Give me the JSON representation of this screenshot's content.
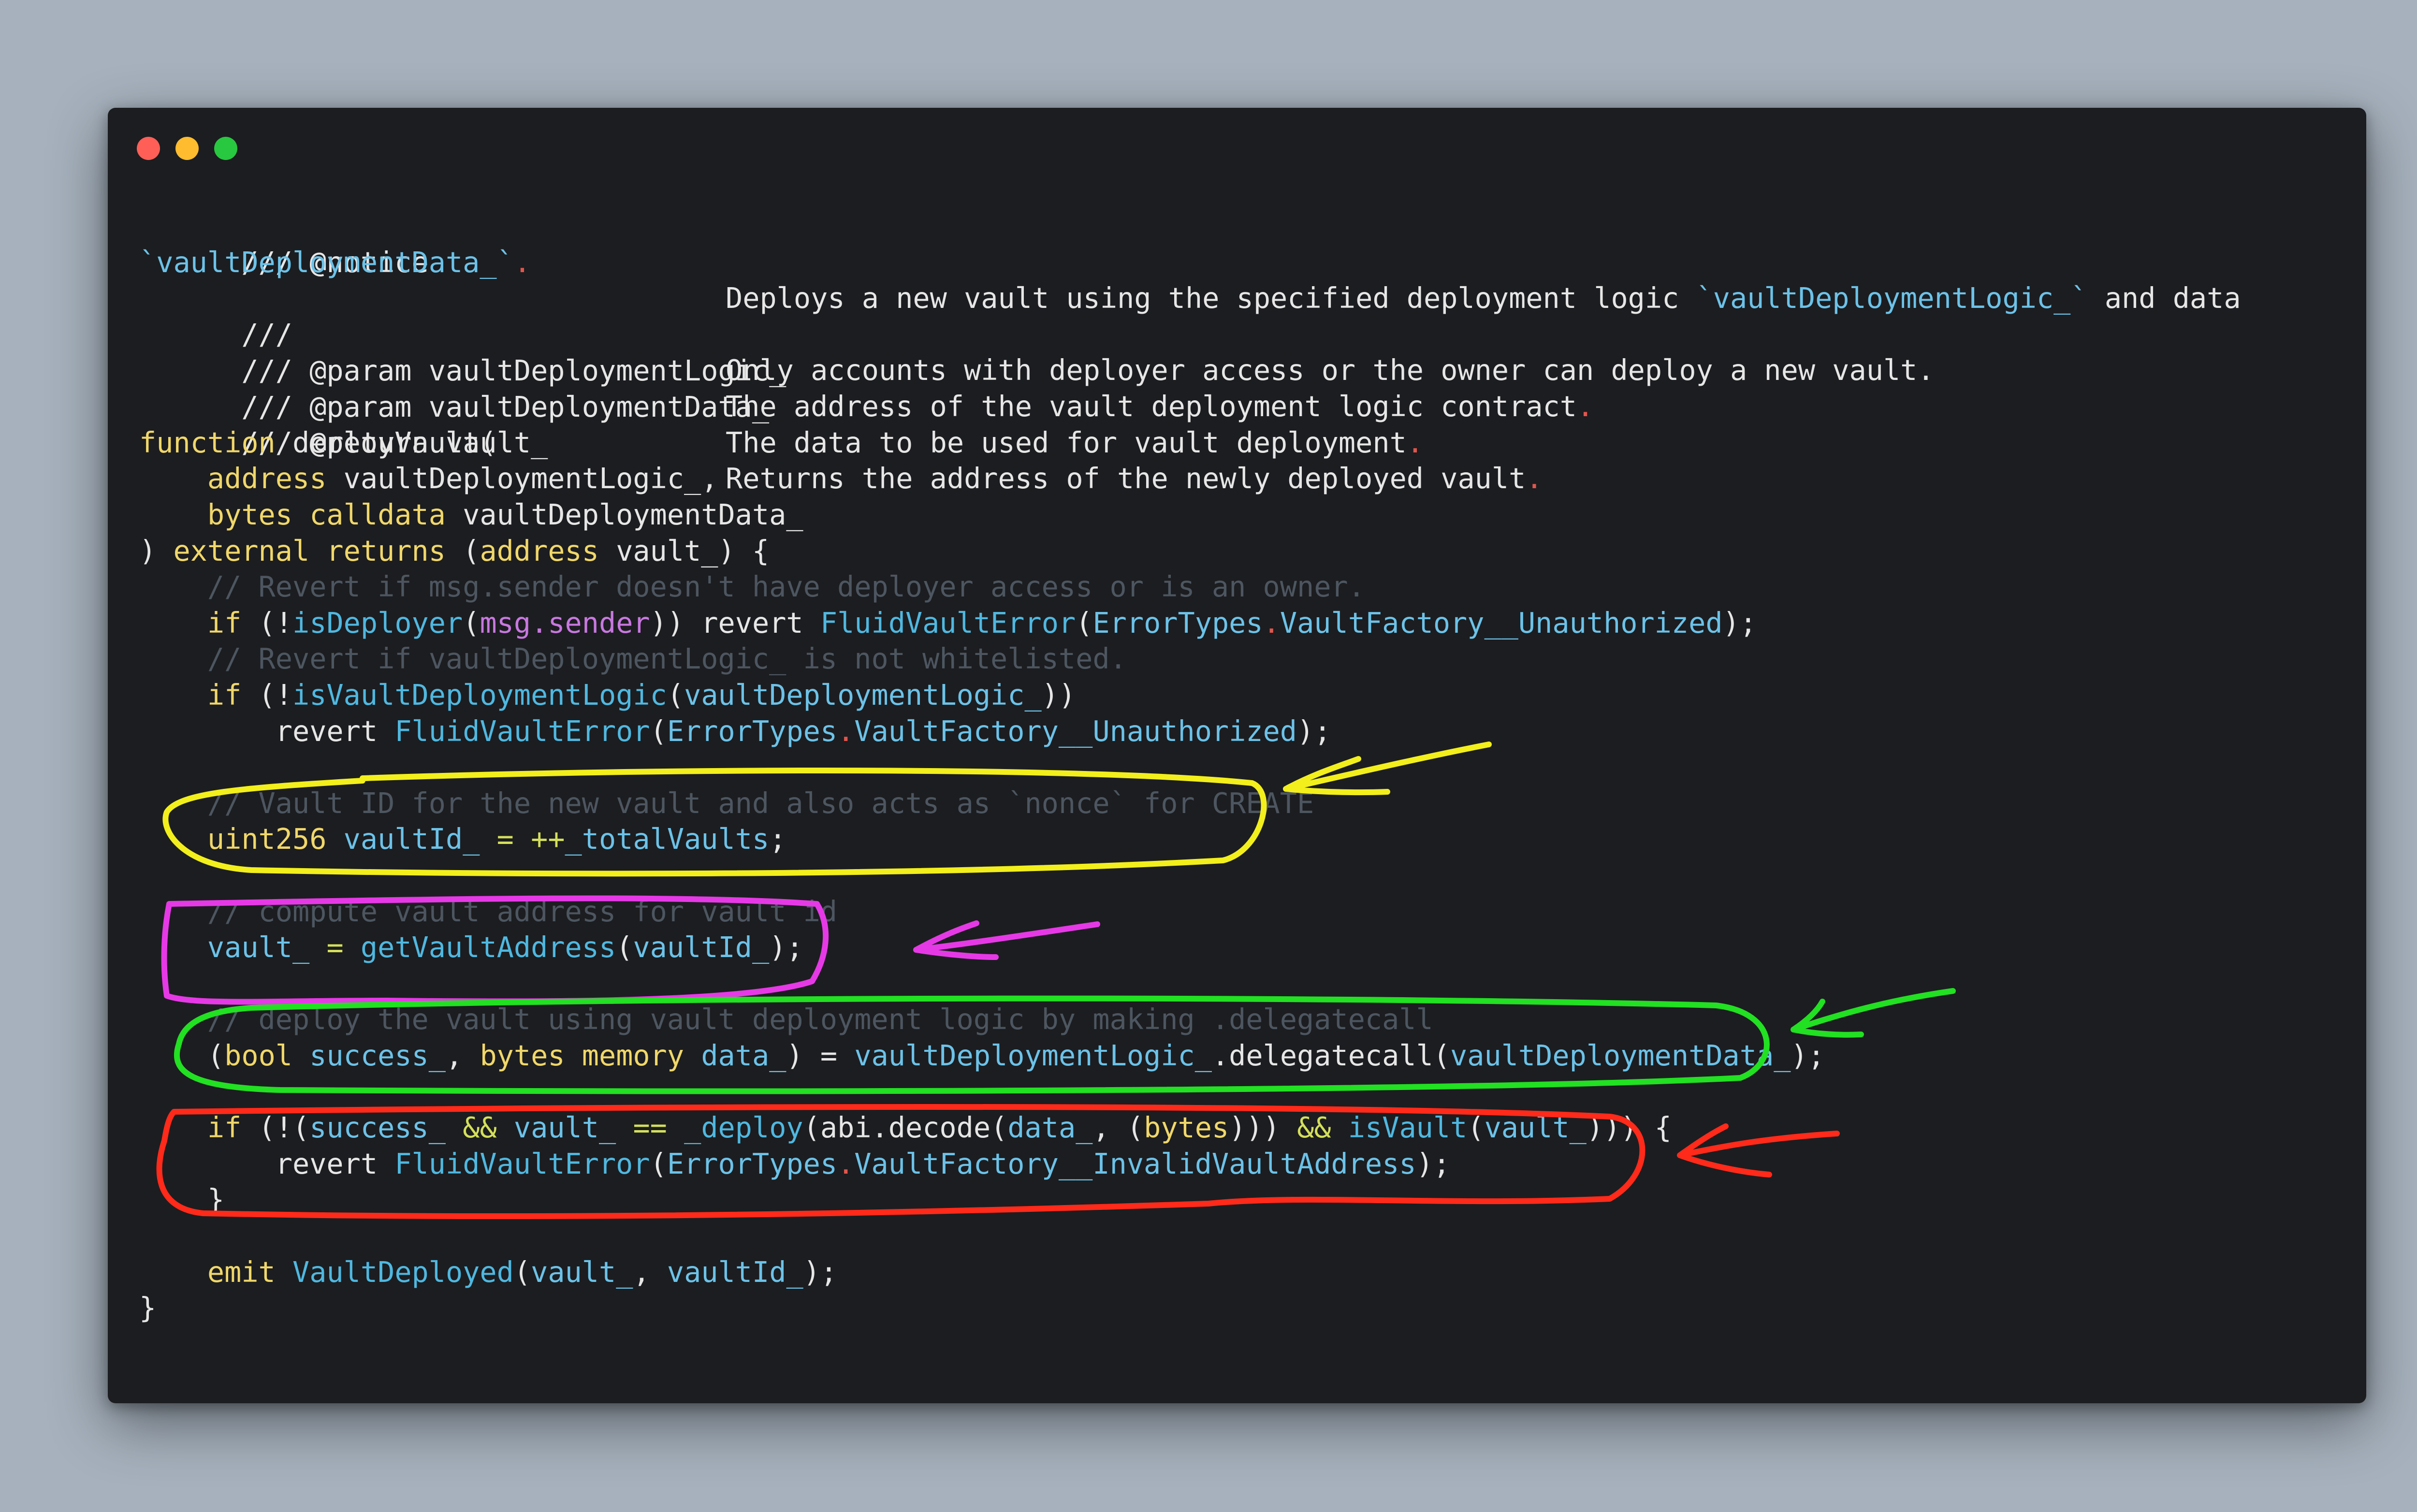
{
  "window": {
    "controls": [
      "close",
      "minimize",
      "maximize"
    ]
  },
  "code": {
    "doc_notice_tag": "/// @notice",
    "doc_notice_text": "Deploys a new vault using the specified deployment logic ",
    "doc_notice_ref1": "`vaultDeploymentLogic_`",
    "doc_notice_and": " and data",
    "doc_notice_ref2": "`vaultDeploymentData_`",
    "doc_notice_end": ".",
    "doc_blank_tag": "///",
    "doc_blank_text": "Only accounts with deployer access or the owner can deploy a new vault.",
    "doc_param1_tag": "/// @param vaultDeploymentLogic_",
    "doc_param1_text": "The address of the vault deployment logic contract",
    "doc_param2_tag": "/// @param vaultDeploymentData_",
    "doc_param2_text": "The data to be used for vault deployment",
    "doc_return_tag": "/// @return vault_",
    "doc_return_text": "Returns the address of the newly deployed vault",
    "dot": ".",
    "fn_kw": "function",
    "fn_name": " deployVault(",
    "p1_type": "address",
    "p1_name": " vaultDeploymentLogic_,",
    "p2_type": "bytes calldata",
    "p2_name": " vaultDeploymentData_",
    "sig_close": ") ",
    "sig_ext": "external returns",
    "sig_open": " (",
    "sig_ret_type": "address",
    "sig_ret_name": " vault_) {",
    "cm1": "// Revert if msg.sender doesn't have deployer access or is an owner.",
    "if_kw": "if",
    "lp_not": " (!",
    "is_deployer": "isDeployer",
    "paren_open": "(",
    "msg_sender": "msg.sender",
    "pp_revert": ")) revert ",
    "fluid_error": "FluidVaultError",
    "error_types": "ErrorTypes",
    "unauthorized": "VaultFactory__Unauthorized",
    "close_semi": ");",
    "cm2": "// Revert if vaultDeploymentLogic_ is not whitelisted.",
    "is_vdl": "isVaultDeploymentLogic",
    "vdl_arg": "vaultDeploymentLogic_",
    "pp": "))",
    "revert_kw": "revert ",
    "cm3": "// Vault ID for the new vault and also acts as `nonce` for CREATE",
    "uint_kw": "uint256",
    "vault_id_var": " vaultId_ ",
    "eq": "= ",
    "inc": "++",
    "total_vaults": "_totalVaults",
    "semi": ";",
    "cm4": "// compute vault address for vault id",
    "vault_var": "vault_",
    "get_vault_address": "getVaultAddress",
    "vault_id_arg": "vaultId_",
    "cm5": "// deploy the vault using vault deployment logic by making .delegatecall",
    "bool_kw": "bool",
    "success_var": " success_",
    "comma": ", ",
    "bytes_memory": "bytes memory",
    "data_var": " data_",
    "assign": ") = ",
    "vdl_var": "vaultDeploymentLogic_",
    "delegatecall": ".delegatecall(",
    "vdd_var": "vaultDeploymentData_",
    "lp_notp": " (!(",
    "success_name": "success_",
    "and_op": " && ",
    "eqeq_op": " == ",
    "deploy_fn": "_deploy",
    "abi_decode": "abi.decode(",
    "data_name": "data_",
    "bytes_kw": "bytes",
    "ppp": ")))",
    "is_vault": "isVault",
    "ppp_brace": "))) {",
    "invalid_vault": "VaultFactory__InvalidVaultAddress",
    "brace_close": "}",
    "emit_kw": "emit",
    "vault_deployed": "VaultDeployed",
    "emit_args_sep": ", ",
    "emit_end": ");"
  },
  "annotations": {
    "yellow": "#f2ef1c",
    "magenta": "#e639e6",
    "green": "#22e022",
    "red": "#ff2a1a"
  }
}
